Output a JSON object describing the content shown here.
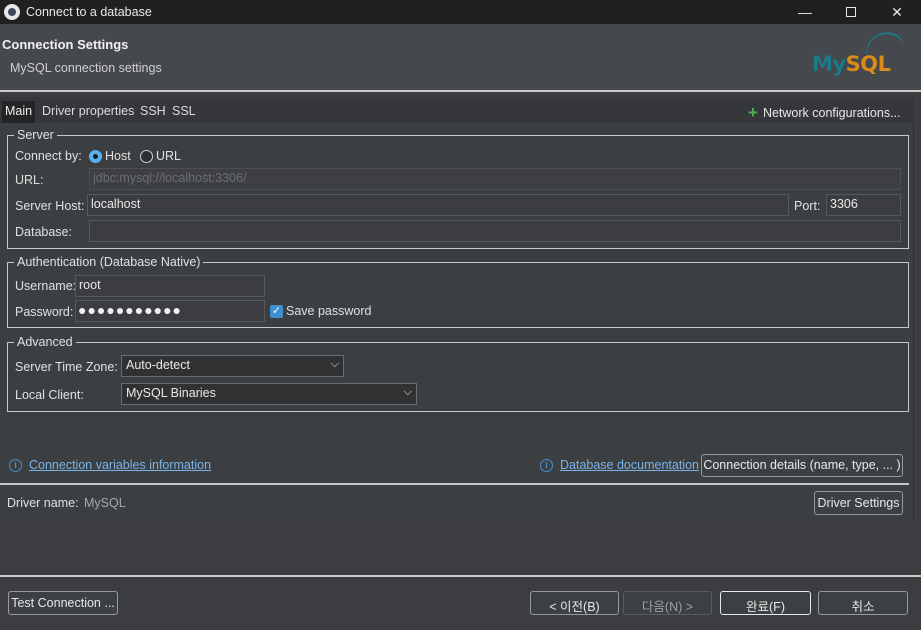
{
  "window": {
    "title": "Connect to a database",
    "minimize": "—",
    "close": "✕"
  },
  "header": {
    "title": "Connection Settings",
    "subtitle": "MySQL connection settings",
    "logo_my": "My",
    "logo_sql": "SQL"
  },
  "tabs": [
    {
      "label": "Main",
      "active": true
    },
    {
      "label": "Driver properties",
      "active": false
    },
    {
      "label": "SSH",
      "active": false
    },
    {
      "label": "SSL",
      "active": false
    }
  ],
  "network_config": {
    "label": "Network configurations...",
    "icon": "plus-icon",
    "icon_glyph": "+"
  },
  "server": {
    "legend": "Server",
    "connect_by_label": "Connect by:",
    "host_option": "Host",
    "url_option": "URL",
    "selected": "Host",
    "url_label": "URL:",
    "url_value": "jdbc:mysql://localhost:3306/",
    "host_label": "Server Host:",
    "host_value": "localhost",
    "port_label": "Port:",
    "port_value": "3306",
    "database_label": "Database:",
    "database_value": ""
  },
  "auth": {
    "legend": "Authentication (Database Native)",
    "username_label": "Username:",
    "username_value": "root",
    "password_label": "Password:",
    "password_mask": "●●●●●●●●●●●",
    "save_password_label": "Save password",
    "save_password_checked": true,
    "checkmark": "✓"
  },
  "advanced": {
    "legend": "Advanced",
    "timezone_label": "Server Time Zone:",
    "timezone_value": "Auto-detect",
    "client_label": "Local Client:",
    "client_value": "MySQL Binaries",
    "dropdown_glyph": "⌵"
  },
  "links": {
    "info_glyph": "i",
    "connection_vars": "Connection variables information",
    "db_docs": "Database documentation",
    "connection_details_button": "Connection details (name, type, ... )"
  },
  "driver": {
    "label": "Driver name:",
    "value": "MySQL",
    "settings_button": "Driver Settings"
  },
  "footer": {
    "test_connection": "Test Connection ...",
    "back": "< 이전(B)",
    "next": "다음(N) >",
    "finish": "완료(F)",
    "cancel": "취소"
  },
  "colors": {
    "accent": "#5ab0e8",
    "link": "#7ab3e8",
    "add": "#4fb04f",
    "logo_teal": "#1a7a8a",
    "logo_orange": "#d88a1a"
  }
}
